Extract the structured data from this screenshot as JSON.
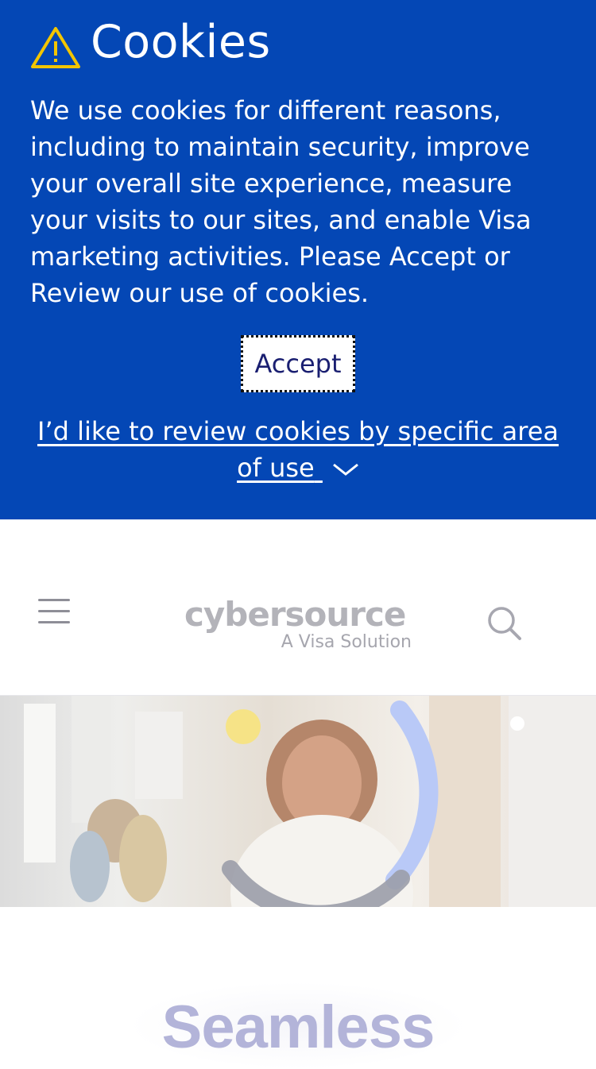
{
  "cookie_banner": {
    "title": "Cookies",
    "body": "We use cookies for different reasons, including to maintain security, improve your overall site experience, measure your visits to our sites, and enable Visa marketing activities. Please Accept or Review our use of cookies.",
    "accept_label": "Accept",
    "review_link": "I’d like to review cookies by specific area of use",
    "icon": "warning-icon",
    "background_color": "#0447b5"
  },
  "header": {
    "logo_main": "cybersource",
    "logo_sub": "A Visa Solution",
    "menu_icon": "hamburger-icon",
    "search_icon": "search-icon"
  },
  "hero": {
    "headline": "Seamless"
  }
}
